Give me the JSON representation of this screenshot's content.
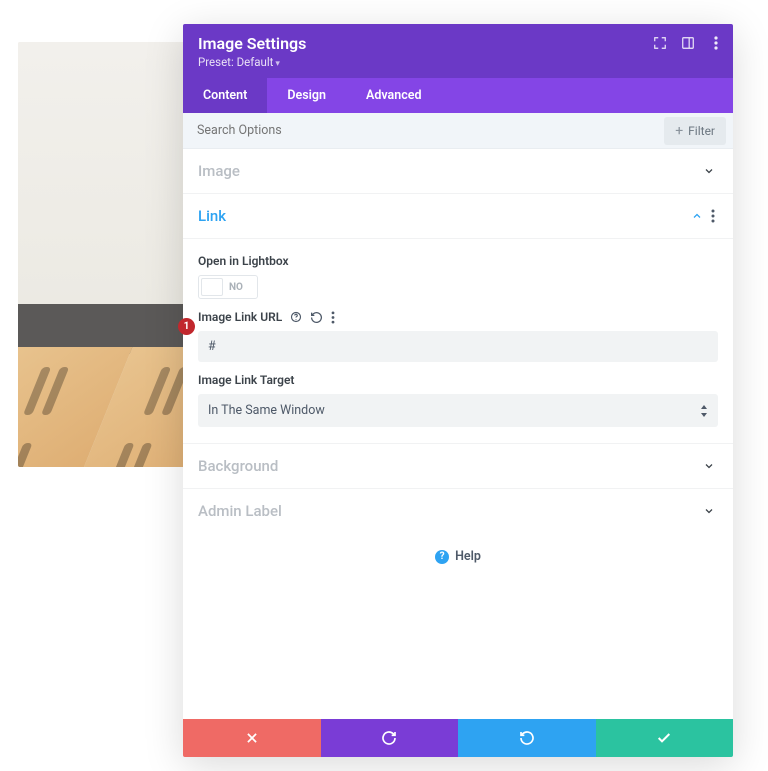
{
  "annotation": {
    "number": "1"
  },
  "header": {
    "title": "Image Settings",
    "preset_label": "Preset: Default"
  },
  "tabs": [
    {
      "label": "Content",
      "active": true
    },
    {
      "label": "Design",
      "active": false
    },
    {
      "label": "Advanced",
      "active": false
    }
  ],
  "search": {
    "placeholder": "Search Options",
    "filter_label": "Filter"
  },
  "sections": {
    "image": {
      "title": "Image",
      "open": false
    },
    "link": {
      "title": "Link",
      "open": true,
      "open_in_lightbox_label": "Open in Lightbox",
      "open_in_lightbox_state": "NO",
      "url_label": "Image Link URL",
      "url_value": "#",
      "target_label": "Image Link Target",
      "target_value": "In The Same Window"
    },
    "background": {
      "title": "Background",
      "open": false
    },
    "admin": {
      "title": "Admin Label",
      "open": false
    }
  },
  "help_label": "Help"
}
